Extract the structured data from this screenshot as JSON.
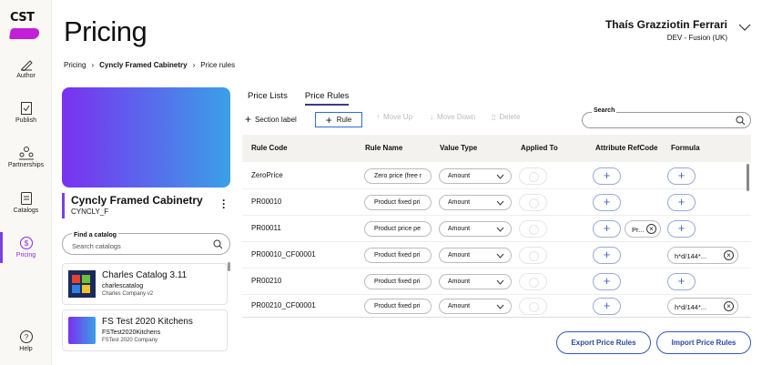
{
  "nav": {
    "logo": "CST",
    "items": [
      {
        "label": "Author",
        "icon": "pen-icon"
      },
      {
        "label": "Publish",
        "icon": "publish-icon"
      },
      {
        "label": "Partnerships",
        "icon": "partnerships-icon"
      },
      {
        "label": "Catalogs",
        "icon": "catalogs-icon"
      },
      {
        "label": "Pricing",
        "icon": "pricing-icon"
      },
      {
        "label": "Help",
        "icon": "help-icon"
      }
    ],
    "accent": "#7b3fe4"
  },
  "header": {
    "title": "Pricing",
    "user_name": "Thaís Grazziotin Ferrari",
    "user_org": "DEV - Fusion (UK)"
  },
  "breadcrumb": [
    "Pricing",
    "Cyncly Framed Cabinetry",
    "Price rules"
  ],
  "catalog": {
    "title": "Cyncly Framed Cabinetry",
    "code": "CYNCLY_F",
    "find_label": "Find a catalog",
    "find_placeholder": "Search catalogs",
    "list": [
      {
        "title": "Charles Catalog 3.11",
        "sub": "charlescatalog",
        "company": "Charles Company v2"
      },
      {
        "title": "FS Test 2020 Kitchens",
        "sub": "FSTest2020Kitchens",
        "company": "FSTest 2020 Company"
      }
    ]
  },
  "tabs": [
    "Price Lists",
    "Price Rules"
  ],
  "toolbar": {
    "section_label": "Section label",
    "rule": "Rule",
    "move_up": "Move Up",
    "move_down": "Move Down",
    "delete": "Delete",
    "search_label": "Search"
  },
  "table": {
    "headers": [
      "Rule Code",
      "Rule Name",
      "Value Type",
      "Applied To",
      "Attribute RefCode",
      "Formula"
    ],
    "rows": [
      {
        "code": "ZeroPrice",
        "name": "Zero price (free r",
        "type": "Amount",
        "attr": "",
        "formula": ""
      },
      {
        "code": "PR00010",
        "name": "Product fixed pri",
        "type": "Amount",
        "attr": "",
        "formula": ""
      },
      {
        "code": "PR00011",
        "name": "Product price pe",
        "type": "Amount",
        "attr": "Pr...",
        "formula": ""
      },
      {
        "code": "PR00010_CF00001",
        "name": "Product fixed pri",
        "type": "Amount",
        "attr": "",
        "formula": "h*d/144*..."
      },
      {
        "code": "PR00210",
        "name": "Product fixed pri",
        "type": "Amount",
        "attr": "",
        "formula": ""
      },
      {
        "code": "PR00210_CF00001",
        "name": "Product fixed pri",
        "type": "Amount",
        "attr": "",
        "formula": "h*d/144*..."
      }
    ]
  },
  "actions": {
    "export": "Export Price Rules",
    "import": "Import Price Rules"
  }
}
